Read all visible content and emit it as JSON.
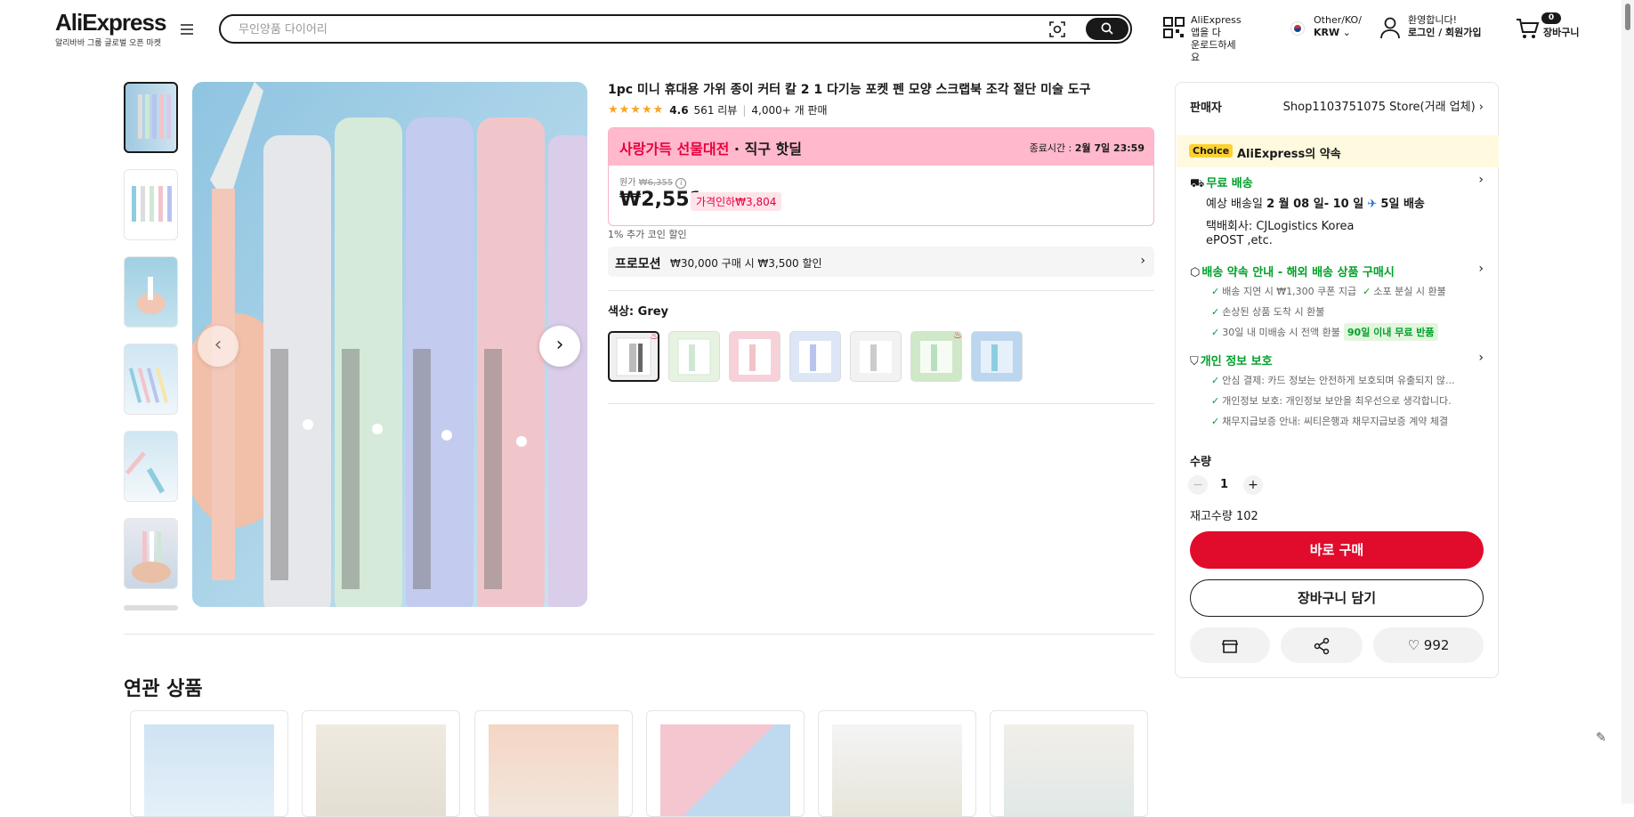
{
  "header": {
    "logo": "AliExpress",
    "logo_sub": "알리바바 그룹 글로벌 오픈 마켓",
    "search_placeholder": "무인양품 다이어리",
    "app_line1": "AliExpress 앱을 다",
    "app_line2": "운로드하세요",
    "region_line1": "Other/KO/",
    "region_line2": "KRW",
    "user_line1": "환영합니다!",
    "user_line2": "로그인 / 회원가입",
    "cart_count": "0",
    "cart_label": "장바구니"
  },
  "product": {
    "title": "1pc 미니 휴대용 가위 종이 커터 칼 2 1 다기능 포켓 펜 모양 스크랩북 조각 절단 미술 도구",
    "rating": "4.6",
    "reviews": "561 리뷰",
    "sold": "4,000+ 개 판매",
    "sale_name_red": "사랑가득 선물대전",
    "sale_name_dark": " · 직구 핫딜",
    "sale_end_label": "종료시간 :",
    "sale_end_value": "2월 7일 23:59",
    "orig_label": "원가",
    "orig_price": "₩6,355",
    "price": "₩2,551",
    "discount": "가격인하₩3,804",
    "coin": "1% 추가 코인 할인",
    "promo_label": "프로모션",
    "promo_text": "₩30,000 구매 시 ₩3,500 할인",
    "color_label": "색상: ",
    "color_value": "Grey"
  },
  "related": {
    "title": "연관 상품"
  },
  "side": {
    "seller_label": "판매자",
    "seller_value": "Shop1103751075 Store(거래 업체)",
    "choice_badge": "Choice",
    "choice_title": "AliExpress의 약속",
    "ship_title": "무료 배송",
    "ship_line1_a": "예상 배송일 ",
    "ship_line1_b": "2 월 08 일- 10 일",
    "ship_line1_c": "5일 배송",
    "ship_line2": "택배회사:  CJLogistics  Korea",
    "ship_line3": "ePOST ,etc.",
    "promise_title": "배송 약속 안내 - 해외 배송 상품 구매시",
    "promise_1": "배송 지연 시 ₩1,300 쿠폰 지급",
    "promise_2": "소포 분실 시 환불",
    "promise_3": "손상된 상품 도착 시 환불",
    "promise_4": "30일 내 미배송 시 전액 환불",
    "promise_tag": "90일 이내 무료 반품",
    "privacy_title": "개인 정보 보호",
    "privacy_1": "안심 결제: 카드 정보는 안전하게 보호되며 유출되지 않...",
    "privacy_2": "개인정보 보호: 개인정보 보안을 최우선으로 생각합니다.",
    "privacy_3": "채무지급보증 안내: 씨티은행과 채무지급보증 계약 체결",
    "qty_label": "수량",
    "qty_value": "1",
    "stock": "재고수량 102",
    "buy": "바로 구매",
    "cart": "장바구니 담기",
    "wish_count": "992"
  },
  "colors": {
    "accent": "#e10b2b",
    "green": "#00a02a",
    "sale_bg": "#ffb8cc"
  }
}
